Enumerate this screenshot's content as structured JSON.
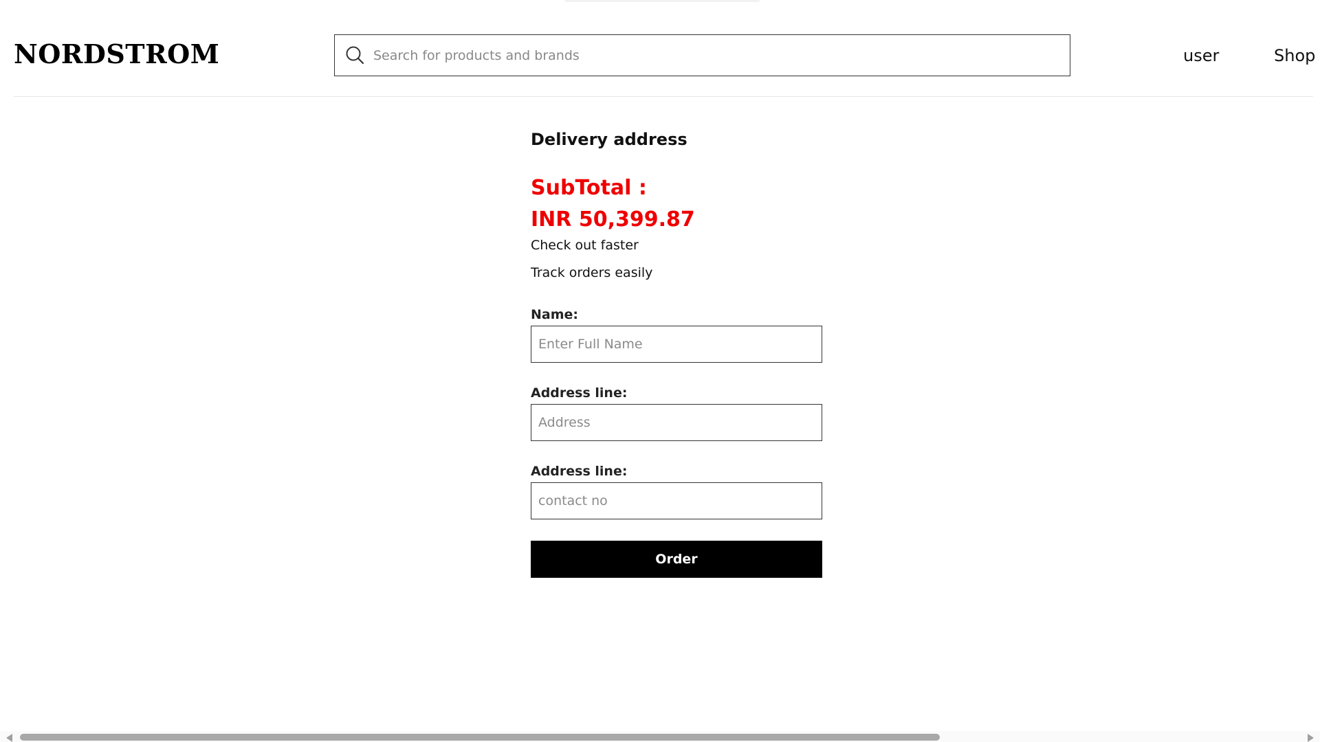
{
  "header": {
    "logo": "NORDSTROM",
    "search": {
      "placeholder": "Search for products and brands",
      "value": "",
      "icon": "search-icon"
    },
    "nav": {
      "user_label": "user",
      "shop_label": "Shop"
    }
  },
  "checkout": {
    "title": "Delivery address",
    "subtotal_label": "SubTotal :",
    "subtotal_value": "INR 50,399.87",
    "perks": [
      "Check out faster",
      "Track orders easily"
    ],
    "fields": [
      {
        "label": "Name:",
        "placeholder": "Enter Full Name",
        "value": ""
      },
      {
        "label": "Address line:",
        "placeholder": "Address",
        "value": ""
      },
      {
        "label": "Address line:",
        "placeholder": "contact no",
        "value": ""
      }
    ],
    "order_button": "Order"
  },
  "colors": {
    "accent_red": "#ee0000",
    "button_bg": "#000000",
    "button_text": "#ffffff"
  }
}
